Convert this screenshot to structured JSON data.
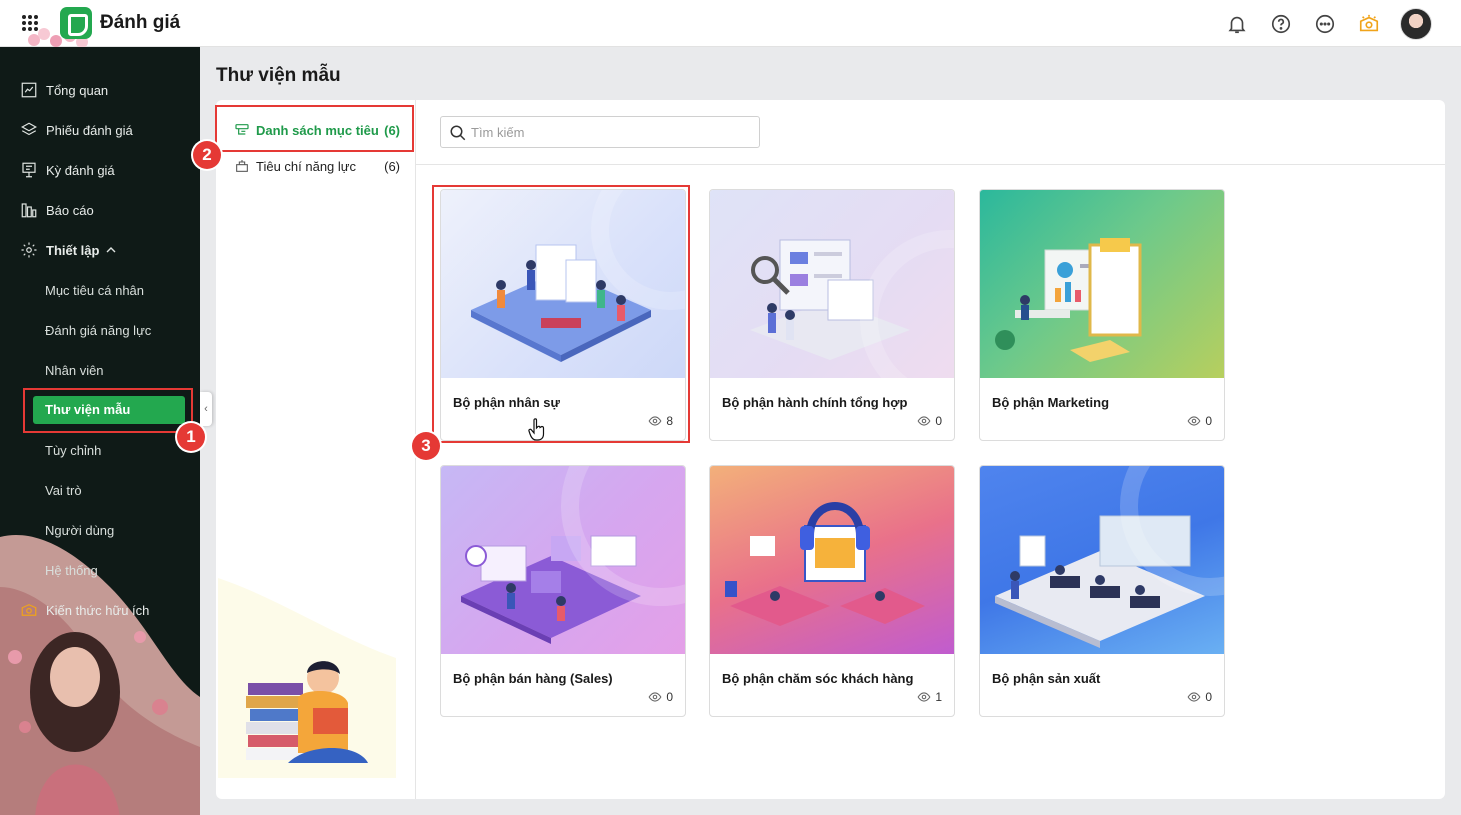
{
  "app": {
    "title": "Đánh giá"
  },
  "page": {
    "title": "Thư viện mẫu"
  },
  "sidebar": {
    "items": [
      {
        "label": "Tổng quan"
      },
      {
        "label": "Phiếu đánh giá"
      },
      {
        "label": "Kỳ đánh giá"
      },
      {
        "label": "Báo cáo"
      },
      {
        "label": "Thiết lập"
      }
    ],
    "sub_items": [
      {
        "label": "Mục tiêu cá nhân"
      },
      {
        "label": "Đánh giá năng lực"
      },
      {
        "label": "Nhân viên"
      },
      {
        "label": "Thư viện mẫu"
      },
      {
        "label": "Tùy chỉnh"
      },
      {
        "label": "Vai trò"
      },
      {
        "label": "Người dùng"
      },
      {
        "label": "Hệ thống"
      }
    ],
    "knowledge": "Kiến thức hữu ích"
  },
  "categories": [
    {
      "label": "Danh sách mục tiêu",
      "count": "(6)"
    },
    {
      "label": "Tiêu chí năng lực",
      "count": "(6)"
    }
  ],
  "search": {
    "placeholder": "Tìm kiếm"
  },
  "cards": [
    {
      "title": "Bộ phận nhân sự",
      "views": "8"
    },
    {
      "title": "Bộ phận hành chính tổng hợp",
      "views": "0"
    },
    {
      "title": "Bộ phận Marketing",
      "views": "0"
    },
    {
      "title": "Bộ phận bán hàng (Sales)",
      "views": "0"
    },
    {
      "title": "Bộ phận chăm sóc khách hàng",
      "views": "1"
    },
    {
      "title": "Bộ phận sản xuất",
      "views": "0"
    }
  ],
  "annotations": [
    "1",
    "2",
    "3"
  ],
  "colors": {
    "accent": "#23a84f",
    "annotation": "#e53935",
    "sidebar_bg": "#0f1a17"
  }
}
